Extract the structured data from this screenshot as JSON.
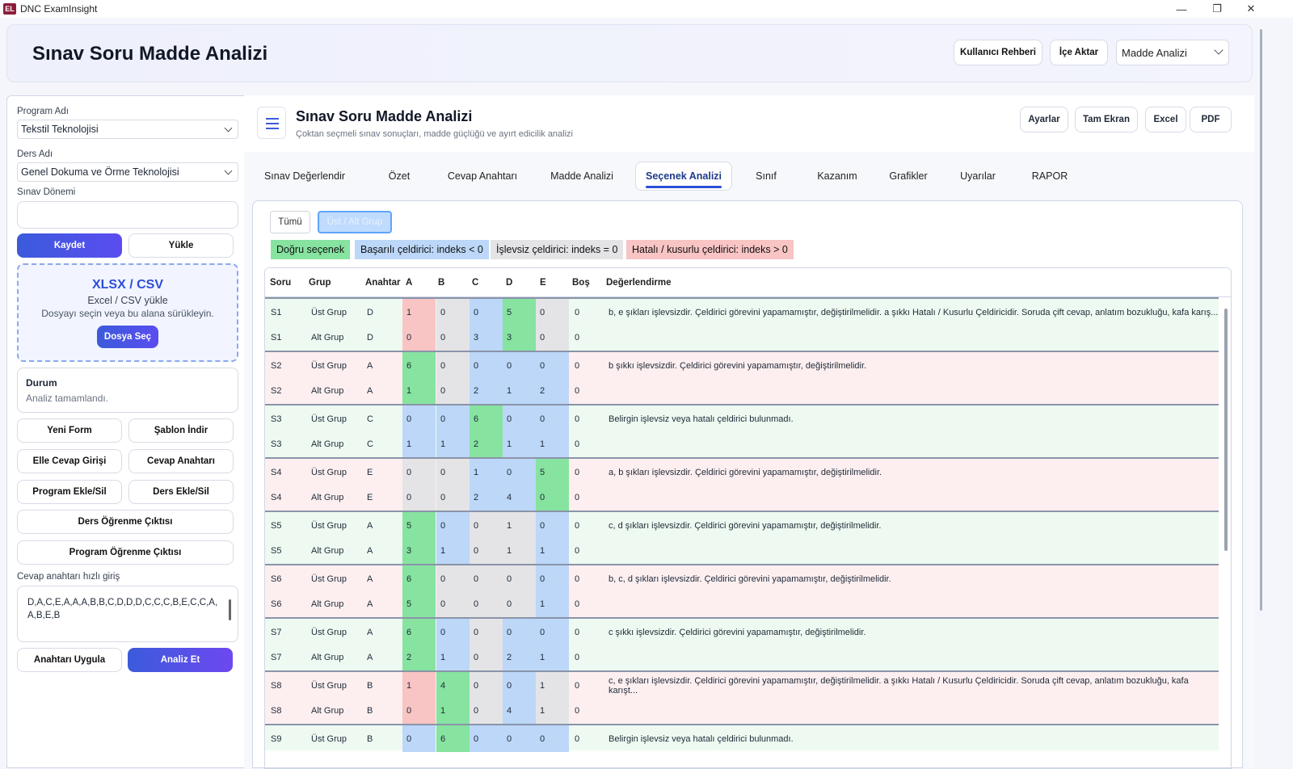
{
  "window": {
    "app_title": "DNC ExamInsight",
    "logo": "EL"
  },
  "header": {
    "title": "Sınav Soru Madde Analizi",
    "guide": "Kullanıcı Rehberi",
    "import": "İçe Aktar",
    "mode": "Madde Analizi"
  },
  "sidebar": {
    "program_label": "Program Adı",
    "program_value": "Tekstil Teknolojisi",
    "course_label": "Ders Adı",
    "course_value": "Genel Dokuma ve Örme Teknolojisi",
    "period_label": "Sınav Dönemi",
    "period_value": "",
    "save": "Kaydet",
    "load": "Yükle",
    "drop_title": "XLSX / CSV",
    "drop_sub": "Excel / CSV yükle",
    "drop_hint": "Dosyayı seçin veya bu alana sürükleyin.",
    "drop_button": "Dosya Seç",
    "status_title": "Durum",
    "status_text": "Analiz tamamlandı.",
    "new_form": "Yeni Form",
    "template": "Şablon İndir",
    "manual": "Elle Cevap Girişi",
    "answer_key": "Cevap Anahtarı",
    "program_edit": "Program Ekle/Sil",
    "course_edit": "Ders Ekle/Sil",
    "course_outcome": "Ders Öğrenme Çıktısı",
    "program_outcome": "Program Öğrenme Çıktısı",
    "quick_label": "Cevap anahtarı hızlı giriş",
    "quick_value": "D,A,C,E,A,A,A,B,B,C,D,D,D,C,C,C,B,E,C,C,A,A,B,E,B",
    "apply": "Anahtarı Uygula",
    "analyze": "Analiz Et"
  },
  "main": {
    "title": "Sınav Soru Madde Analizi",
    "subtitle": "Çoktan seçmeli sınav sonuçları, madde güçlüğü ve ayırt edicilik analizi",
    "buttons": {
      "settings": "Ayarlar",
      "fullscreen": "Tam Ekran",
      "excel": "Excel",
      "pdf": "PDF"
    },
    "tabs": [
      "Sınav Değerlendir",
      "Özet",
      "Cevap Anahtarı",
      "Madde Analizi",
      "Seçenek Analizi",
      "Sınıf",
      "Kazanım",
      "Grafikler",
      "Uyarılar",
      "RAPOR"
    ],
    "active_tab": "Seçenek Analizi",
    "toggle_all": "Tümü",
    "toggle_group": "Üst / Alt Grup",
    "legend": {
      "correct": "Doğru seçenek",
      "good": "Başarılı çeldirici: indeks < 0",
      "useless": "İşlevsiz çeldirici: indeks = 0",
      "faulty": "Hatalı / kusurlu çeldirici: indeks > 0"
    },
    "colors": {
      "correct": "#86e3a0",
      "good": "#bcd7f8",
      "useless": "#e4e4e6",
      "faulty": "#f8c4c4",
      "row_green": "#eefaf1",
      "row_red": "#fdeff0"
    },
    "columns": [
      "Soru",
      "Grup",
      "Anahtar",
      "A",
      "B",
      "C",
      "D",
      "E",
      "Boş",
      "Değerlendirme"
    ],
    "rows": [
      {
        "q": "S1",
        "g": "Üst Grup",
        "k": "D",
        "v": [
          "1",
          "0",
          "0",
          "5",
          "0"
        ],
        "b": "0",
        "cls": [
          "faulty",
          "useless",
          "good",
          "correct",
          "useless"
        ],
        "e": "b, e şıkları işlevsizdir. Çeldirici görevini yapamamıştır, değiştirilmelidir. a şıkkı Hatalı / Kusurlu Çeldiricidir. Soruda çift cevap, anlatım bozukluğu, kafa karış...",
        "bg": "green"
      },
      {
        "q": "S1",
        "g": "Alt Grup",
        "k": "D",
        "v": [
          "0",
          "0",
          "3",
          "3",
          "0"
        ],
        "b": "0",
        "cls": [
          "faulty",
          "useless",
          "good",
          "correct",
          "useless"
        ],
        "e": "",
        "bg": "green"
      },
      {
        "q": "S2",
        "g": "Üst Grup",
        "k": "A",
        "v": [
          "6",
          "0",
          "0",
          "0",
          "0"
        ],
        "b": "0",
        "cls": [
          "correct",
          "useless",
          "good",
          "good",
          "good"
        ],
        "e": "b şıkkı işlevsizdir. Çeldirici görevini yapamamıştır, değiştirilmelidir.",
        "bg": "red"
      },
      {
        "q": "S2",
        "g": "Alt Grup",
        "k": "A",
        "v": [
          "1",
          "0",
          "2",
          "1",
          "2"
        ],
        "b": "0",
        "cls": [
          "correct",
          "useless",
          "good",
          "good",
          "good"
        ],
        "e": "",
        "bg": "red"
      },
      {
        "q": "S3",
        "g": "Üst Grup",
        "k": "C",
        "v": [
          "0",
          "0",
          "6",
          "0",
          "0"
        ],
        "b": "0",
        "cls": [
          "good",
          "good",
          "correct",
          "good",
          "good"
        ],
        "e": "Belirgin işlevsiz veya hatalı çeldirici bulunmadı.",
        "bg": "green"
      },
      {
        "q": "S3",
        "g": "Alt Grup",
        "k": "C",
        "v": [
          "1",
          "1",
          "2",
          "1",
          "1"
        ],
        "b": "0",
        "cls": [
          "good",
          "good",
          "correct",
          "good",
          "good"
        ],
        "e": "",
        "bg": "green"
      },
      {
        "q": "S4",
        "g": "Üst Grup",
        "k": "E",
        "v": [
          "0",
          "0",
          "1",
          "0",
          "5"
        ],
        "b": "0",
        "cls": [
          "useless",
          "useless",
          "good",
          "good",
          "correct"
        ],
        "e": "a, b şıkları işlevsizdir. Çeldirici görevini yapamamıştır, değiştirilmelidir.",
        "bg": "red"
      },
      {
        "q": "S4",
        "g": "Alt Grup",
        "k": "E",
        "v": [
          "0",
          "0",
          "2",
          "4",
          "0"
        ],
        "b": "0",
        "cls": [
          "useless",
          "useless",
          "good",
          "good",
          "correct"
        ],
        "e": "",
        "bg": "red"
      },
      {
        "q": "S5",
        "g": "Üst Grup",
        "k": "A",
        "v": [
          "5",
          "0",
          "0",
          "1",
          "0"
        ],
        "b": "0",
        "cls": [
          "correct",
          "good",
          "useless",
          "useless",
          "good"
        ],
        "e": "c, d şıkları işlevsizdir. Çeldirici görevini yapamamıştır, değiştirilmelidir.",
        "bg": "green"
      },
      {
        "q": "S5",
        "g": "Alt Grup",
        "k": "A",
        "v": [
          "3",
          "1",
          "0",
          "1",
          "1"
        ],
        "b": "0",
        "cls": [
          "correct",
          "good",
          "useless",
          "useless",
          "good"
        ],
        "e": "",
        "bg": "green"
      },
      {
        "q": "S6",
        "g": "Üst Grup",
        "k": "A",
        "v": [
          "6",
          "0",
          "0",
          "0",
          "0"
        ],
        "b": "0",
        "cls": [
          "correct",
          "useless",
          "useless",
          "useless",
          "good"
        ],
        "e": "b, c, d şıkları işlevsizdir. Çeldirici görevini yapamamıştır, değiştirilmelidir.",
        "bg": "red"
      },
      {
        "q": "S6",
        "g": "Alt Grup",
        "k": "A",
        "v": [
          "5",
          "0",
          "0",
          "0",
          "1"
        ],
        "b": "0",
        "cls": [
          "correct",
          "useless",
          "useless",
          "useless",
          "good"
        ],
        "e": "",
        "bg": "red"
      },
      {
        "q": "S7",
        "g": "Üst Grup",
        "k": "A",
        "v": [
          "6",
          "0",
          "0",
          "0",
          "0"
        ],
        "b": "0",
        "cls": [
          "correct",
          "good",
          "useless",
          "good",
          "good"
        ],
        "e": "c şıkkı işlevsizdir. Çeldirici görevini yapamamıştır, değiştirilmelidir.",
        "bg": "green"
      },
      {
        "q": "S7",
        "g": "Alt Grup",
        "k": "A",
        "v": [
          "2",
          "1",
          "0",
          "2",
          "1"
        ],
        "b": "0",
        "cls": [
          "correct",
          "good",
          "useless",
          "good",
          "good"
        ],
        "e": "",
        "bg": "green"
      },
      {
        "q": "S8",
        "g": "Üst Grup",
        "k": "B",
        "v": [
          "1",
          "4",
          "0",
          "0",
          "1"
        ],
        "b": "0",
        "cls": [
          "faulty",
          "correct",
          "useless",
          "good",
          "useless"
        ],
        "e": "c, e şıkları işlevsizdir. Çeldirici görevini yapamamıştır, değiştirilmelidir. a şıkkı Hatalı / Kusurlu Çeldiricidir. Soruda çift cevap, anlatım bozukluğu, kafa karışt...",
        "bg": "red"
      },
      {
        "q": "S8",
        "g": "Alt Grup",
        "k": "B",
        "v": [
          "0",
          "1",
          "0",
          "4",
          "1"
        ],
        "b": "0",
        "cls": [
          "faulty",
          "correct",
          "useless",
          "good",
          "useless"
        ],
        "e": "",
        "bg": "red"
      },
      {
        "q": "S9",
        "g": "Üst Grup",
        "k": "B",
        "v": [
          "0",
          "6",
          "0",
          "0",
          "0"
        ],
        "b": "0",
        "cls": [
          "good",
          "correct",
          "good",
          "good",
          "good"
        ],
        "e": "Belirgin işlevsiz veya hatalı çeldirici bulunmadı.",
        "bg": "green"
      }
    ]
  }
}
